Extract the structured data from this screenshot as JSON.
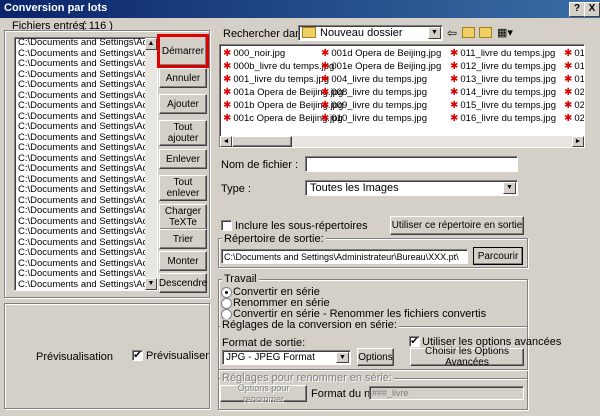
{
  "window": {
    "title": "Conversion par lots",
    "help_label": "?",
    "close_label": "X"
  },
  "left": {
    "files_label": "Fichiers entrés:",
    "files_count": "( 116 )",
    "file_list": [
      "C:\\Documents and Settings\\Admini",
      "C:\\Documents and Settings\\Admini",
      "C:\\Documents and Settings\\Admini",
      "C:\\Documents and Settings\\Admini",
      "C:\\Documents and Settings\\Admini",
      "C:\\Documents and Settings\\Admini",
      "C:\\Documents and Settings\\Admini",
      "C:\\Documents and Settings\\Admini",
      "C:\\Documents and Settings\\Admini",
      "C:\\Documents and Settings\\Admini",
      "C:\\Documents and Settings\\Admini",
      "C:\\Documents and Settings\\Admini",
      "C:\\Documents and Settings\\Admini",
      "C:\\Documents and Settings\\Admini",
      "C:\\Documents and Settings\\Admini",
      "C:\\Documents and Settings\\Admini",
      "C:\\Documents and Settings\\Admini",
      "C:\\Documents and Settings\\Admini",
      "C:\\Documents and Settings\\Admini",
      "C:\\Documents and Settings\\Admini",
      "C:\\Documents and Settings\\Admini",
      "C:\\Documents and Settings\\Admini",
      "C:\\Documents and Settings\\Admini",
      "C:\\Documents and Settings\\Admini",
      "C:\\Documents and Settings\\Admini"
    ],
    "buttons": {
      "start": "Démarrer",
      "cancel": "Annuler",
      "add": "Ajouter",
      "add_all": "Tout ajouter",
      "remove": "Enlever",
      "remove_all": "Tout enlever",
      "load_text": "Charger TeXTe",
      "sort": "Trier",
      "move_up": "Monter",
      "move_down": "Descendre"
    },
    "preview_label": "Prévisualisation",
    "preview_checkbox": "Prévisualiser"
  },
  "browser": {
    "search_label": "Rechercher dans :",
    "folder": "Nouveau dossier",
    "files": [
      [
        "000_noir.jpg",
        "000b_livre du temps.jpg",
        "001_livre du temps.jpg",
        "001a Opera de Beijing.jpg",
        "001b Opera de Beijing.jpg",
        "001c Opera de Beijing.jpg"
      ],
      [
        "001d Opera de Beijing.jpg",
        "001e Opera de Beijing.jpg",
        "004_livre du temps.jpg",
        "008_livre du temps.jpg",
        "009_livre du temps.jpg",
        "010_livre du temps.jpg"
      ],
      [
        "011_livre du temps.jpg",
        "012_livre du temps.jpg",
        "013_livre du temps.jpg",
        "014_livre du temps.jpg",
        "015_livre du temps.jpg",
        "016_livre du temps.jpg"
      ],
      [
        "01",
        "01",
        "01",
        "02",
        "02",
        "02"
      ]
    ],
    "filename_label": "Nom de fichier :",
    "filename_value": "",
    "type_label": "Type :",
    "type_value": "Toutes les Images"
  },
  "output": {
    "subfolders_label": "Inclure les sous-répertoires",
    "use_folder_button": "Utiliser ce répertoire en sortie",
    "output_dir_label": "Répertoire de sortie:",
    "output_dir_value": "C:\\Documents and Settings\\Administrateur\\Bureau\\XXX.pt\\",
    "browse_button": "Parcourir"
  },
  "work": {
    "group_label": "Travail",
    "options": [
      "Convertir en série",
      "Renommer en série",
      "Convertir en série - Renommer les fichiers convertis"
    ],
    "conversion_group": "Réglages de la conversion en série:",
    "format_label": "Format de sortie:",
    "format_value": "JPG - JPEG Format",
    "options_button": "Options",
    "advanced_checkbox": "Utiliser les options avancées",
    "advanced_button": "Choisir les Options Avancées",
    "rename_group": "Réglages pour renommer en série:",
    "rename_button": "Options pour renommer",
    "name_format_label": "Format du nom:",
    "name_format_value": "###_livre"
  }
}
